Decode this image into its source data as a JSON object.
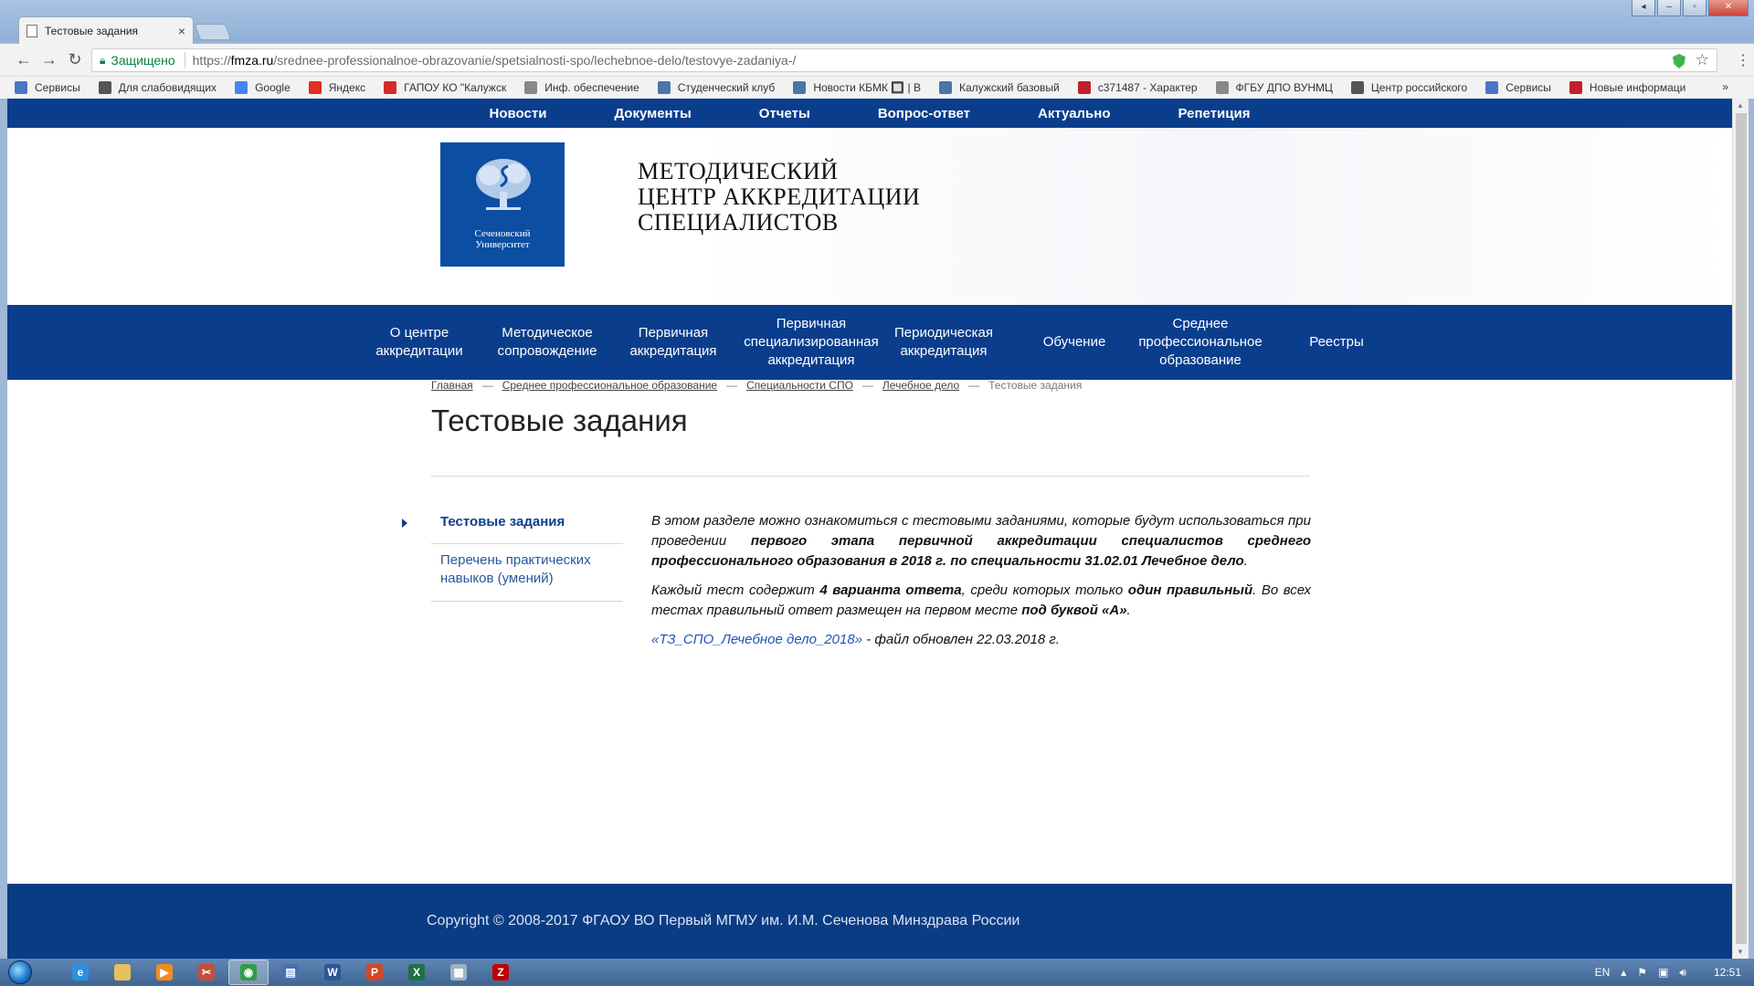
{
  "browser": {
    "tab_title": "Тестовые задания",
    "tab_close": "×",
    "secure_label": "Защищено",
    "url_scheme": "https://",
    "url_host": "fmza.ru",
    "url_path": "/srednee-professionalnoe-obrazovanie/spetsialnosti-spo/lechebnoe-delo/testovye-zadaniya-/",
    "bookmarks": [
      {
        "label": "Сервисы",
        "icon": "apps-grid-icon",
        "color": "#4a76c9"
      },
      {
        "label": "Для слабовидящих",
        "icon": "wordpress-icon",
        "color": "#555555"
      },
      {
        "label": "Google",
        "icon": "google-icon",
        "color": "#4285f4"
      },
      {
        "label": "Яндекс",
        "icon": "yandex-icon",
        "color": "#e03020"
      },
      {
        "label": "ГАПОУ КО \"Калужск",
        "icon": "site-icon",
        "color": "#d42a2a"
      },
      {
        "label": "Инф. обеспечение",
        "icon": "page-icon",
        "color": "#888888"
      },
      {
        "label": "Студенческий клуб",
        "icon": "vk-icon",
        "color": "#4a76a8"
      },
      {
        "label": "Новости КБМК 🔲 | В",
        "icon": "vk-icon",
        "color": "#4a76a8"
      },
      {
        "label": "Калужский базовый",
        "icon": "vk-icon",
        "color": "#4a76a8"
      },
      {
        "label": "с371487 - Характер",
        "icon": "m-icon",
        "color": "#c0202c"
      },
      {
        "label": "ФГБУ ДПО ВУНМЦ",
        "icon": "page-icon",
        "color": "#888888"
      },
      {
        "label": "Центр российского",
        "icon": "book-icon",
        "color": "#555555"
      },
      {
        "label": "Сервисы",
        "icon": "apps-grid-icon",
        "color": "#4a76c9"
      },
      {
        "label": "Новые информаци",
        "icon": "site-icon",
        "color": "#c0202c"
      }
    ],
    "bookmarks_more": "»"
  },
  "site": {
    "top_nav": [
      "Новости",
      "Документы",
      "Отчеты",
      "Вопрос-ответ",
      "Актуально",
      "Репетиция"
    ],
    "logo_text_1": "Сеченовский",
    "logo_text_2": "Университет",
    "title_line1": "Методический",
    "title_line2": "центр аккредитации",
    "title_line3": "специалистов",
    "main_nav": [
      "О центре аккредитации",
      "Методическое сопровождение",
      "Первичная аккредитация",
      "Первичная специализированная аккредитация",
      "Периодическая аккредитация",
      "Обучение",
      "Среднее профессиональное образование",
      "Реестры"
    ],
    "breadcrumb": [
      "Главная",
      "Среднее профессиональное образование",
      "Специальности СПО",
      "Лечебное дело",
      "Тестовые задания"
    ],
    "breadcrumb_sep": "—",
    "page_title": "Тестовые задания",
    "sidebar": [
      "Тестовые задания",
      "Перечень практических навыков (умений)"
    ],
    "p1_a": "В этом разделе можно ознакомиться с тестовыми заданиями, которые будут использоваться при проведении ",
    "p1_b": "первого этапа первичной аккредитации специалистов среднего профессионального образования в 2018 г. по специальности 31.02.01 Лечебное дело",
    "p1_c": ".",
    "p2_a": "Каждый тест содержит ",
    "p2_b": "4 варианта ответа",
    "p2_c": ", среди которых только ",
    "p2_d": "один правильный",
    "p2_e": ". Во всех тестах правильный  ответ размещен на первом месте  ",
    "p2_f": "под буквой «А»",
    "p2_g": ".",
    "file_link": "«ТЗ_СПО_Лечебное дело_2018»",
    "file_note": " - файл обновлен 22.03.2018 г.",
    "footer": "Copyright © 2008-2017 ФГАОУ ВО Первый МГМУ им. И.М. Сеченова Минздрава России"
  },
  "taskbar": {
    "apps": [
      {
        "icon": "ie-icon",
        "color": "#2d8fe0",
        "glyph": "e"
      },
      {
        "icon": "folder-icon",
        "color": "#e8c15a",
        "glyph": ""
      },
      {
        "icon": "media-player-icon",
        "color": "#f28c1e",
        "glyph": "▶"
      },
      {
        "icon": "tool-icon",
        "color": "#c94b3a",
        "glyph": "✂"
      },
      {
        "icon": "chrome-icon",
        "color": "#2f9e44",
        "glyph": "◉"
      },
      {
        "icon": "disk-icon",
        "color": "#4a6fb5",
        "glyph": "▤"
      },
      {
        "icon": "word-icon",
        "color": "#2b5797",
        "glyph": "W"
      },
      {
        "icon": "powerpoint-icon",
        "color": "#d24726",
        "glyph": "P"
      },
      {
        "icon": "excel-icon",
        "color": "#1e7145",
        "glyph": "X"
      },
      {
        "icon": "notepad-icon",
        "color": "#9fb3c8",
        "glyph": "▦"
      },
      {
        "icon": "filezilla-icon",
        "color": "#bf0000",
        "glyph": "Z"
      }
    ],
    "lang": "EN",
    "clock": "12:51"
  }
}
